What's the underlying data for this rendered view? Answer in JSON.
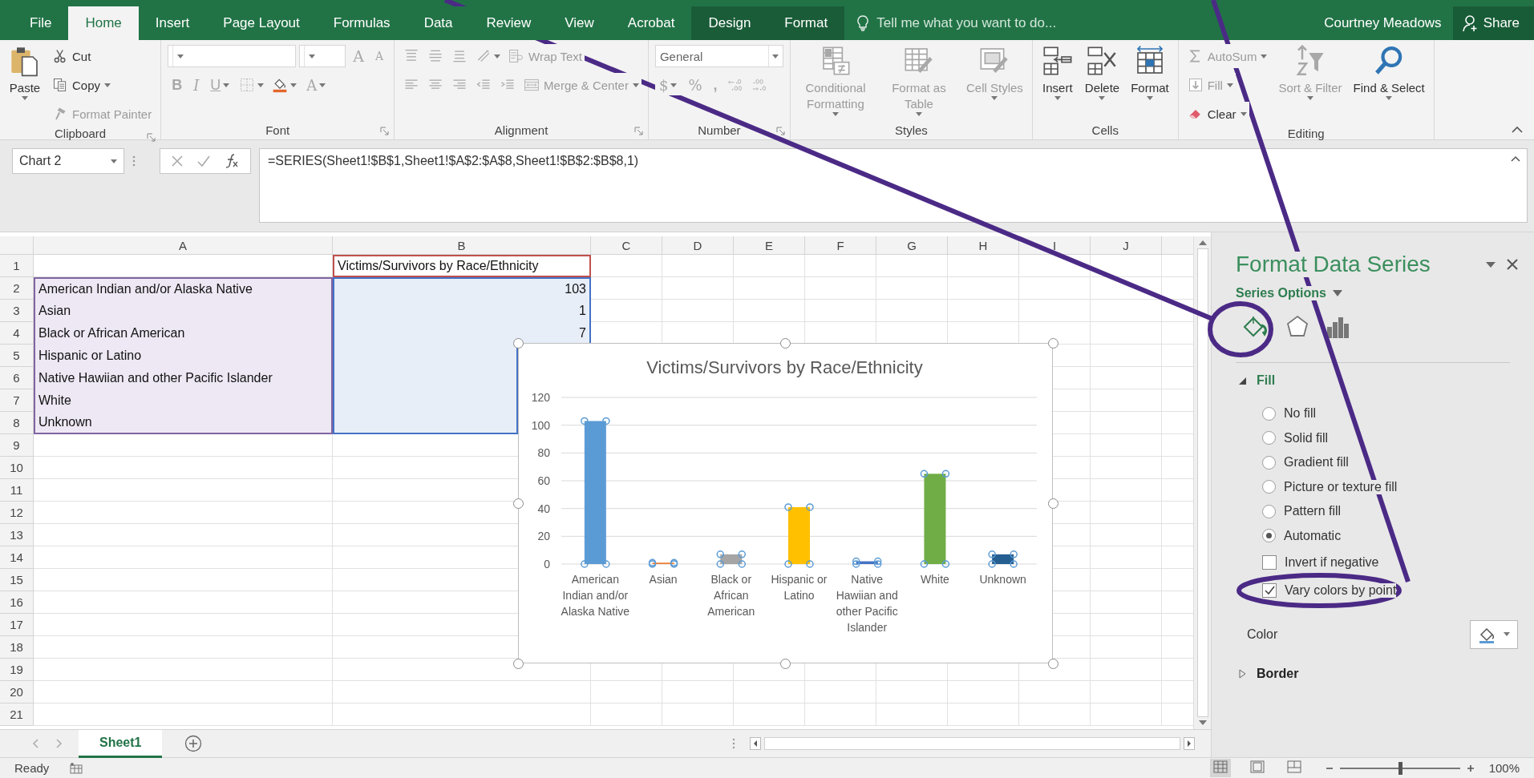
{
  "ribbon_tabs": [
    {
      "label": "File",
      "selected": false,
      "contextual": false
    },
    {
      "label": "Home",
      "selected": true,
      "contextual": false
    },
    {
      "label": "Insert",
      "selected": false,
      "contextual": false
    },
    {
      "label": "Page Layout",
      "selected": false,
      "contextual": false
    },
    {
      "label": "Formulas",
      "selected": false,
      "contextual": false
    },
    {
      "label": "Data",
      "selected": false,
      "contextual": false
    },
    {
      "label": "Review",
      "selected": false,
      "contextual": false
    },
    {
      "label": "View",
      "selected": false,
      "contextual": false
    },
    {
      "label": "Acrobat",
      "selected": false,
      "contextual": false
    },
    {
      "label": "Design",
      "selected": false,
      "contextual": true
    },
    {
      "label": "Format",
      "selected": false,
      "contextual": true
    }
  ],
  "tell_me": {
    "placeholder": "Tell me what you want to do..."
  },
  "user": "Courtney Meadows",
  "share": "Share",
  "ribbon_groups": [
    {
      "label": "Clipboard",
      "launcher": true,
      "columns": [
        {
          "rows": [
            [
              {
                "kind": "large",
                "label": "Paste",
                "menu": true,
                "disabled": false
              }
            ]
          ]
        },
        {
          "rows": [
            [
              {
                "kind": "small",
                "label": "Cut",
                "menu": false,
                "disabled": false
              }
            ],
            [
              {
                "kind": "small",
                "label": "Copy",
                "menu": true,
                "disabled": false
              }
            ],
            [
              {
                "kind": "small",
                "label": "Format Painter",
                "menu": false,
                "disabled": true
              }
            ]
          ]
        }
      ]
    },
    {
      "label": "Font",
      "launcher": true,
      "columns": [
        {
          "rows": [
            [
              {
                "kind": "combo",
                "disabled": true
              },
              {
                "kind": "combo",
                "disabled": true
              },
              {
                "kind": "glyph",
                "text": "A",
                "menu": false,
                "disabled": true
              },
              {
                "kind": "glyph",
                "text": "A",
                "menu": false,
                "disabled": true
              }
            ],
            [
              {
                "kind": "glyph",
                "text": "B",
                "menu": false,
                "disabled": true
              },
              {
                "kind": "glyph",
                "text": "I",
                "menu": false,
                "disabled": true
              },
              {
                "kind": "glyph",
                "text": "U",
                "menu": true,
                "disabled": true
              },
              {
                "kind": "icon",
                "menu": true,
                "disabled": true
              },
              {
                "kind": "icon",
                "menu": true,
                "disabled": false
              },
              {
                "kind": "glyph",
                "text": "A",
                "menu": true,
                "disabled": true
              }
            ]
          ]
        }
      ]
    },
    {
      "label": "Alignment",
      "launcher": true,
      "columns": [
        {
          "rows": [
            [
              {
                "kind": "icon",
                "menu": false,
                "disabled": true
              },
              {
                "kind": "icon",
                "menu": false,
                "disabled": true
              },
              {
                "kind": "icon",
                "menu": false,
                "disabled": true
              },
              {
                "kind": "icon",
                "menu": true,
                "disabled": true
              },
              {
                "kind": "small",
                "label": "Wrap Text",
                "menu": false,
                "disabled": true
              }
            ],
            [
              {
                "kind": "icon",
                "menu": false,
                "disabled": true
              },
              {
                "kind": "icon",
                "menu": false,
                "disabled": true
              },
              {
                "kind": "icon",
                "menu": false,
                "disabled": true
              },
              {
                "kind": "icon",
                "menu": false,
                "disabled": true
              },
              {
                "kind": "icon",
                "menu": false,
                "disabled": true
              },
              {
                "kind": "small",
                "label": "Merge & Center",
                "menu": true,
                "disabled": true
              }
            ]
          ]
        }
      ]
    },
    {
      "label": "Number",
      "launcher": true,
      "columns": [
        {
          "rows": [
            [
              {
                "kind": "combo",
                "value": "General",
                "disabled": true
              }
            ],
            [
              {
                "kind": "glyph",
                "text": "$",
                "menu": true,
                "disabled": true
              },
              {
                "kind": "glyph",
                "text": "%",
                "menu": false,
                "disabled": true
              },
              {
                "kind": "glyph",
                "text": ",",
                "menu": false,
                "disabled": true
              },
              {
                "kind": "icon",
                "menu": false,
                "disabled": true
              },
              {
                "kind": "icon",
                "menu": false,
                "disabled": true
              }
            ]
          ]
        }
      ]
    },
    {
      "label": "Styles",
      "launcher": false,
      "columns": [
        {
          "rows": [
            [
              {
                "kind": "large",
                "label": "Conditional Formatting",
                "menu": true,
                "disabled": true
              }
            ]
          ]
        },
        {
          "rows": [
            [
              {
                "kind": "large",
                "label": "Format as Table",
                "menu": true,
                "disabled": true
              }
            ]
          ]
        },
        {
          "rows": [
            [
              {
                "kind": "large",
                "label": "Cell Styles",
                "menu": true,
                "disabled": true
              }
            ]
          ]
        }
      ]
    },
    {
      "label": "Cells",
      "launcher": false,
      "columns": [
        {
          "rows": [
            [
              {
                "kind": "large",
                "label": "Insert",
                "menu": true,
                "disabled": false
              }
            ]
          ]
        },
        {
          "rows": [
            [
              {
                "kind": "large",
                "label": "Delete",
                "menu": true,
                "disabled": false
              }
            ]
          ]
        },
        {
          "rows": [
            [
              {
                "kind": "large",
                "label": "Format",
                "menu": true,
                "disabled": false
              }
            ]
          ]
        }
      ]
    },
    {
      "label": "Editing",
      "launcher": false,
      "columns": [
        {
          "rows": [
            [
              {
                "kind": "small",
                "label": "AutoSum",
                "menu": true,
                "disabled": true
              }
            ],
            [
              {
                "kind": "small",
                "label": "Fill",
                "menu": true,
                "disabled": true
              }
            ],
            [
              {
                "kind": "small",
                "label": "Clear",
                "menu": true,
                "disabled": false
              }
            ]
          ]
        },
        {
          "rows": [
            [
              {
                "kind": "large",
                "label": "Sort & Filter",
                "menu": true,
                "disabled": true
              }
            ]
          ]
        },
        {
          "rows": [
            [
              {
                "kind": "large",
                "label": "Find & Select",
                "menu": true,
                "disabled": false
              }
            ]
          ]
        }
      ]
    }
  ],
  "formula_bar": {
    "name_box": "Chart 2",
    "formula": "=SERIES(Sheet1!$B$1,Sheet1!$A$2:$A$8,Sheet1!$B$2:$B$8,1)"
  },
  "sheet": {
    "columns": [
      "A",
      "B",
      "C",
      "D",
      "E",
      "F",
      "G",
      "H",
      "I",
      "J"
    ],
    "rows": [
      {
        "number": "1",
        "b": {
          "text": "Victims/Survivors by Race/Ethnicity",
          "kind": "series-name"
        }
      },
      {
        "number": "2",
        "a": {
          "text": "American Indian and/or Alaska Native",
          "kind": "category"
        },
        "b": {
          "text": "103",
          "kind": "value"
        }
      },
      {
        "number": "3",
        "a": {
          "text": "Asian",
          "kind": "category"
        },
        "b": {
          "text": "1",
          "kind": "value"
        }
      },
      {
        "number": "4",
        "a": {
          "text": "Black or African American",
          "kind": "category"
        },
        "b": {
          "text": "7",
          "kind": "value"
        }
      },
      {
        "number": "5",
        "a": {
          "text": "Hispanic or Latino",
          "kind": "category"
        },
        "b": {
          "kind": "value"
        }
      },
      {
        "number": "6",
        "a": {
          "text": "Native Hawiian and other Pacific Islander",
          "kind": "category"
        },
        "b": {
          "kind": "value"
        }
      },
      {
        "number": "7",
        "a": {
          "text": "White",
          "kind": "category"
        },
        "b": {
          "kind": "value"
        }
      },
      {
        "number": "8",
        "a": {
          "text": "Unknown",
          "kind": "category"
        },
        "b": {
          "kind": "value"
        }
      },
      {
        "number": "9"
      },
      {
        "number": "10"
      },
      {
        "number": "11"
      },
      {
        "number": "12"
      },
      {
        "number": "13"
      },
      {
        "number": "14"
      },
      {
        "number": "15"
      },
      {
        "number": "16"
      },
      {
        "number": "17"
      },
      {
        "number": "18"
      },
      {
        "number": "19"
      },
      {
        "number": "20"
      },
      {
        "number": "21"
      }
    ],
    "chart": {
      "selected": true,
      "points": [
        {
          "color": "#5b9bd5"
        },
        {
          "color": "#ed7d31"
        },
        {
          "color": "#a5a5a5"
        },
        {
          "color": "#ffc000"
        },
        {
          "color": "#4472c4"
        },
        {
          "color": "#70ad47"
        },
        {
          "color": "#255e91"
        }
      ],
      "chart_data": {
        "type": "bar",
        "title": "Victims/Survivors by Race/Ethnicity",
        "categories": [
          "American Indian and/or Alaska Native",
          "Asian",
          "Black or African American",
          "Hispanic or Latino",
          "Native Hawiian and other Pacific Islander",
          "White",
          "Unknown"
        ],
        "values": [
          103,
          1,
          7,
          41,
          2,
          65,
          7
        ],
        "ylim": [
          0,
          120
        ],
        "yticks": [
          0,
          20,
          40,
          60,
          80,
          100,
          120
        ],
        "grid": true
      }
    }
  },
  "sheet_tabs": [
    {
      "label": "Sheet1",
      "selected": true
    }
  ],
  "format_pane": {
    "title": "Format Data Series",
    "subtitle": "Series Options",
    "icon_tabs": [
      {
        "kind": "fill",
        "selected": true
      },
      {
        "kind": "effects",
        "selected": false
      },
      {
        "kind": "series",
        "selected": false
      }
    ],
    "sections": [
      {
        "label": "Fill",
        "expanded": true,
        "options": [
          {
            "kind": "radio",
            "label": "No fill",
            "selected": false
          },
          {
            "kind": "radio",
            "label": "Solid fill",
            "selected": false
          },
          {
            "kind": "radio",
            "label": "Gradient fill",
            "selected": false
          },
          {
            "kind": "radio",
            "label": "Picture or texture fill",
            "selected": false
          },
          {
            "kind": "radio",
            "label": "Pattern fill",
            "selected": false
          },
          {
            "kind": "radio",
            "label": "Automatic",
            "selected": true
          },
          {
            "kind": "checkbox",
            "label": "Invert if negative",
            "checked": false
          },
          {
            "kind": "checkbox",
            "label": "Vary colors by point",
            "checked": true
          },
          {
            "kind": "color",
            "label": "Color"
          }
        ]
      },
      {
        "label": "Border",
        "expanded": false
      }
    ]
  },
  "status_bar": {
    "status": "Ready",
    "views": [
      {
        "kind": "normal",
        "selected": true
      },
      {
        "kind": "page-layout",
        "selected": false
      },
      {
        "kind": "page-break",
        "selected": false
      }
    ],
    "zoom": {
      "level": 0.5,
      "reading": "100%"
    }
  }
}
